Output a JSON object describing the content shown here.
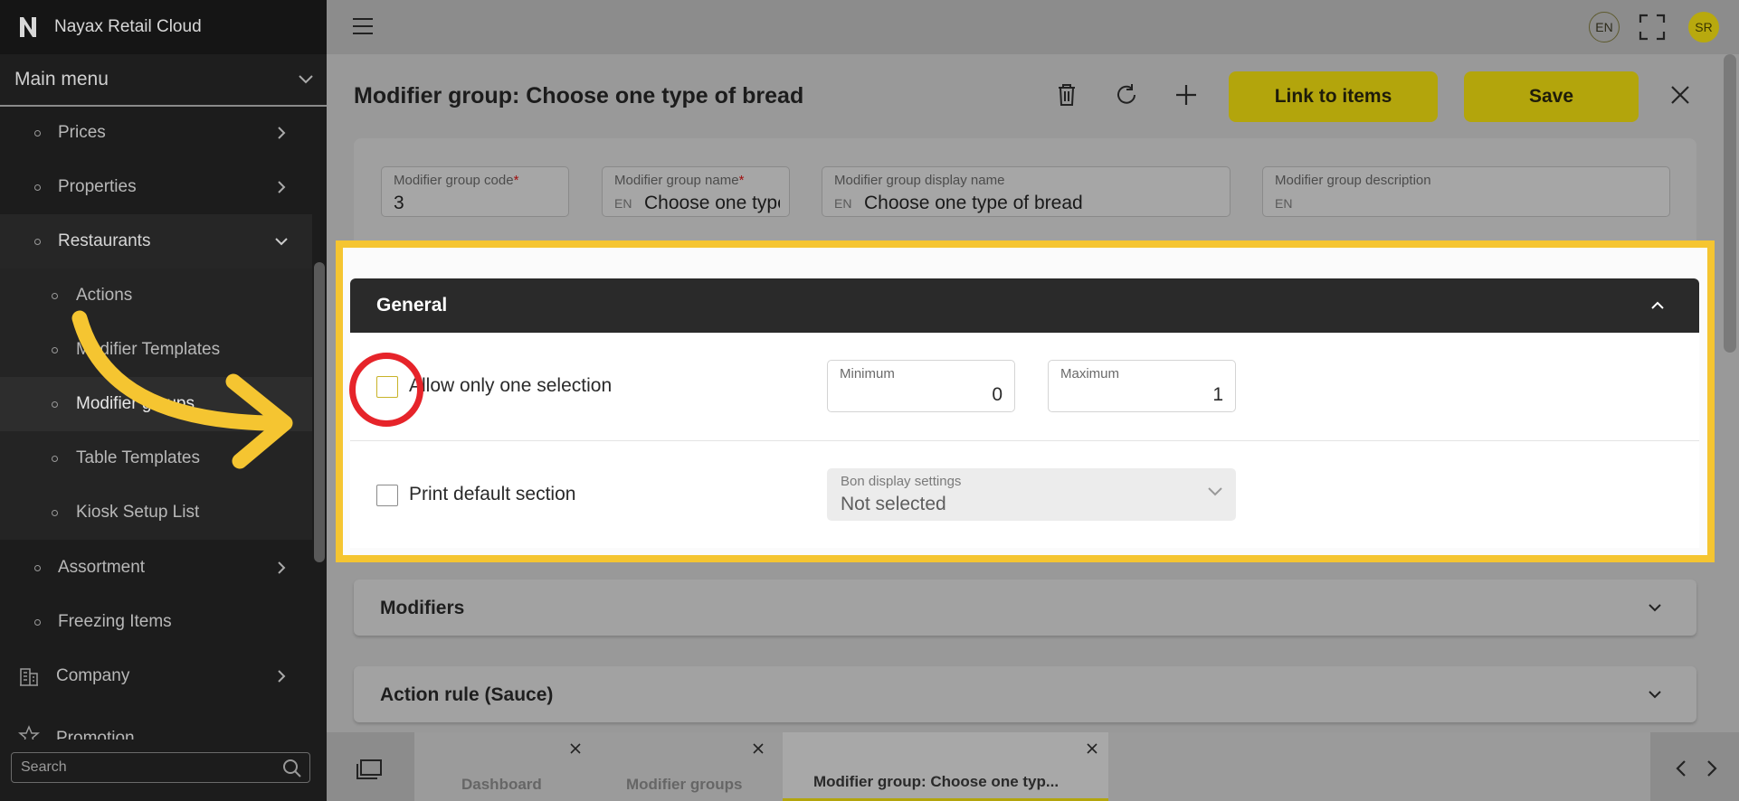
{
  "app": {
    "title": "Nayax Retail Cloud"
  },
  "sidebar": {
    "menu_title": "Main menu",
    "items": [
      {
        "label": "Prices"
      },
      {
        "label": "Properties"
      },
      {
        "label": "Restaurants"
      },
      {
        "label": "Actions"
      },
      {
        "label": "Modifier Templates"
      },
      {
        "label": "Modifier groups"
      },
      {
        "label": "Table Templates"
      },
      {
        "label": "Kiosk Setup List"
      },
      {
        "label": "Assortment"
      },
      {
        "label": "Freezing Items"
      },
      {
        "label": "Company"
      },
      {
        "label": "Promotion"
      }
    ],
    "search_placeholder": "Search"
  },
  "topbar": {
    "language": "EN",
    "avatar_initials": "SR"
  },
  "page": {
    "title": "Modifier group: Choose one type of bread",
    "link_button": "Link to items",
    "save_button": "Save"
  },
  "fields": {
    "code": {
      "label": "Modifier group code",
      "required": "*",
      "value": "3"
    },
    "name": {
      "label": "Modifier group name",
      "required": "*",
      "lang": "EN",
      "value": "Choose one type of bread"
    },
    "display_name": {
      "label": "Modifier group display name",
      "lang": "EN",
      "value": "Choose one type of bread"
    },
    "description": {
      "label": "Modifier group description",
      "lang": "EN",
      "value": ""
    }
  },
  "general": {
    "title": "General",
    "allow_one_label": "Allow only one selection",
    "allow_one_checked": false,
    "minimum_label": "Minimum",
    "minimum_value": "0",
    "maximum_label": "Maximum",
    "maximum_value": "1",
    "print_default_label": "Print default section",
    "print_default_checked": false,
    "bon_label": "Bon display settings",
    "bon_value": "Not selected"
  },
  "sections": {
    "modifiers": "Modifiers",
    "action_rule": "Action rule (Sauce)"
  },
  "tabs": [
    {
      "label": "Dashboard"
    },
    {
      "label": "Modifier groups"
    },
    {
      "label": "Modifier group: Choose one typ..."
    }
  ],
  "colors": {
    "accent": "#b3a50c",
    "highlight": "#f5c531",
    "annotation_red": "#e6242a",
    "sidebar_bg": "#1c1c1c"
  }
}
